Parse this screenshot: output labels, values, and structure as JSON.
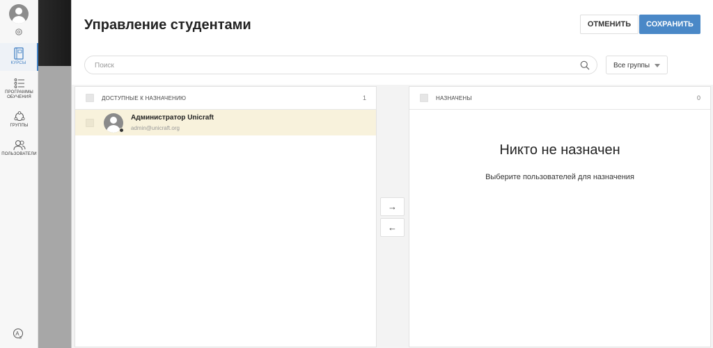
{
  "nav": {
    "items": [
      {
        "label": "КУРСЫ",
        "icon": "book-icon",
        "active": true
      },
      {
        "label": "ПРОГРАММЫ ОБУЧЕНИЯ",
        "icon": "list-icon",
        "active": false
      },
      {
        "label": "ГРУППЫ",
        "icon": "groups-icon",
        "active": false
      },
      {
        "label": "ПОЛЬЗОВАТЕЛИ",
        "icon": "users-icon",
        "active": false
      }
    ]
  },
  "header": {
    "title": "Управление студентами",
    "cancel_label": "ОТМЕНИТЬ",
    "save_label": "СОХРАНИТЬ"
  },
  "search": {
    "placeholder": "Поиск",
    "value": ""
  },
  "groups_select": {
    "selected": "Все группы"
  },
  "available": {
    "title": "ДОСТУПНЫЕ К НАЗНАЧЕНИЮ",
    "count": "1",
    "users": [
      {
        "name": "Администратор Unicraft",
        "email": "admin@unicraft.org"
      }
    ]
  },
  "assigned": {
    "title": "НАЗНАЧЕНЫ",
    "count": "0",
    "empty_title": "Никто не назначен",
    "empty_subtitle": "Выберите пользователей для назначения"
  },
  "transfer": {
    "right_label": "→",
    "left_label": "←"
  },
  "colors": {
    "accent": "#4a88c7",
    "selected_row": "#f8f2dc"
  }
}
